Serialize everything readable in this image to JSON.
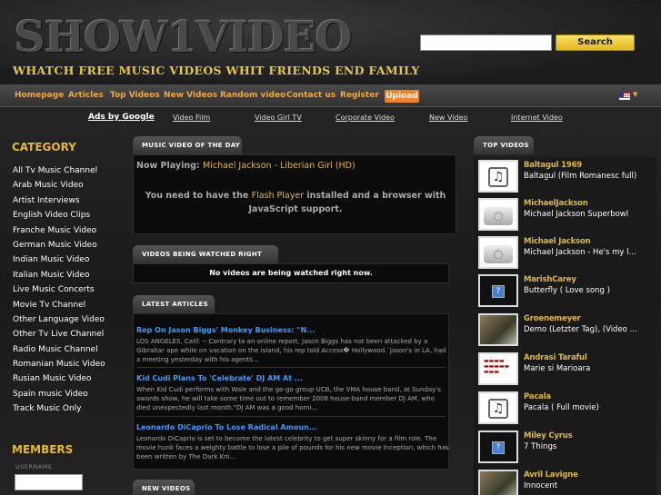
{
  "header": {
    "logo": "SHOW1VIDEO",
    "tagline": "WHATCH FREE MUSIC VIDEOS WHIT FRIENDS END FAMILY",
    "search_button": "Search",
    "search_value": ""
  },
  "nav": {
    "items": [
      "Homepage",
      "Articles",
      "Top Videos",
      "New Videos",
      "Random video",
      "Contact us",
      "Register"
    ],
    "upload": "Upload"
  },
  "ads": {
    "label": "Ads by Google",
    "links": [
      "Video Film",
      "Video Girl TV",
      "Corporate Video",
      "New Video",
      "Internet Video"
    ]
  },
  "sidebar": {
    "category_title": "CATEGORY",
    "categories": [
      "All Tv Music Channel",
      "Arab Music Video",
      "Artist Interviews",
      "English Video Clips",
      "Franche Music Video",
      "German Music Video",
      "Indian Music Video",
      "Italian Music Video",
      "Live Music Concerts",
      "Movie Tv Channel",
      "Other Language Video",
      "Other Tv Live Channel",
      "Radio Music Channel",
      "Romanian Music Video",
      "Rusian Music Video",
      "Spain music Video",
      "Track Music Only"
    ],
    "members_title": "MEMBERS",
    "username_label": "USERNAME"
  },
  "main": {
    "video_of_day_title": "MUSIC VIDEO OF THE DAY",
    "now_playing_label": "Now Playing:",
    "now_playing_value": "Michael Jackson - Liberian Girl (HD)",
    "flash_text_1": "You need to have the",
    "flash_link": "Flash Player",
    "flash_text_2": "installed and a browser with JavaScript support.",
    "watching_title": "VIDEOS BEING WATCHED RIGHT NOW",
    "watching_message": "No videos are being watched right now.",
    "articles_title": "LATEST ARTICLES",
    "articles": [
      {
        "title": "Rep On Jason Biggs' Monkey Business: \"N...",
        "body": "LOS ANGELES, Calif. -- Contrary to an online report, Jason Biggs has not been attacked by a Gibraltar ape while on vacation on the island, his rep told Access� Hollywood.`Jason's in LA, had a meeting yesterday with his agents..."
      },
      {
        "title": "Kid Cudi Plans To 'Celebrate' DJ AM At ...",
        "body": "When Kid Cudi performs with Wale and the go-go group UCB, the VMA house band, at Sunday's awards show, he will take some time out to remember 2008 house-band member DJ AM, who died unexpectedly last month.\"DJ AM was a good homi..."
      },
      {
        "title": "Leonardo DiCaprio To Lose Radical Amoun...",
        "body": "Leonardo DiCaprio is set to become the latest celebrity to get super skinny for a film role. The movie hunk faces a weighty battle to lose a pile of pounds for his new movie Inception, which has been written by The Dark Kni..."
      }
    ],
    "new_videos_title": "NEW VIDEOS"
  },
  "top_videos": {
    "title": "TOP VIDEOS",
    "items": [
      {
        "name": "Baltagul 1969",
        "title": "Baltagul (Film Romanesc full)",
        "thumb": "music-note-icon"
      },
      {
        "name": "MichaelJackson",
        "title": "Michael Jackson Superbowl",
        "thumb": "video-camera-icon"
      },
      {
        "name": "Michael Jackson",
        "title": "Michael Jackson - He's my l...",
        "thumb": "video-camera-icon"
      },
      {
        "name": "MarishCarey",
        "title": "Butterfly ( Love song )",
        "thumb": "question-icon"
      },
      {
        "name": "Groenemeyer",
        "title": "Demo (Letzter Tag), (Video ...",
        "thumb": "scene-icon"
      },
      {
        "name": "Andrasi Taraful",
        "title": "Marie si Marioara",
        "thumb": "text-icon"
      },
      {
        "name": "Pacala",
        "title": "Pacala ( Full movie)",
        "thumb": "music-note-icon"
      },
      {
        "name": "Miley Cyrus",
        "title": "7 Things",
        "thumb": "question-icon"
      },
      {
        "name": "Avril Lavigne",
        "title": "Innocent",
        "thumb": "scene-icon"
      }
    ]
  }
}
